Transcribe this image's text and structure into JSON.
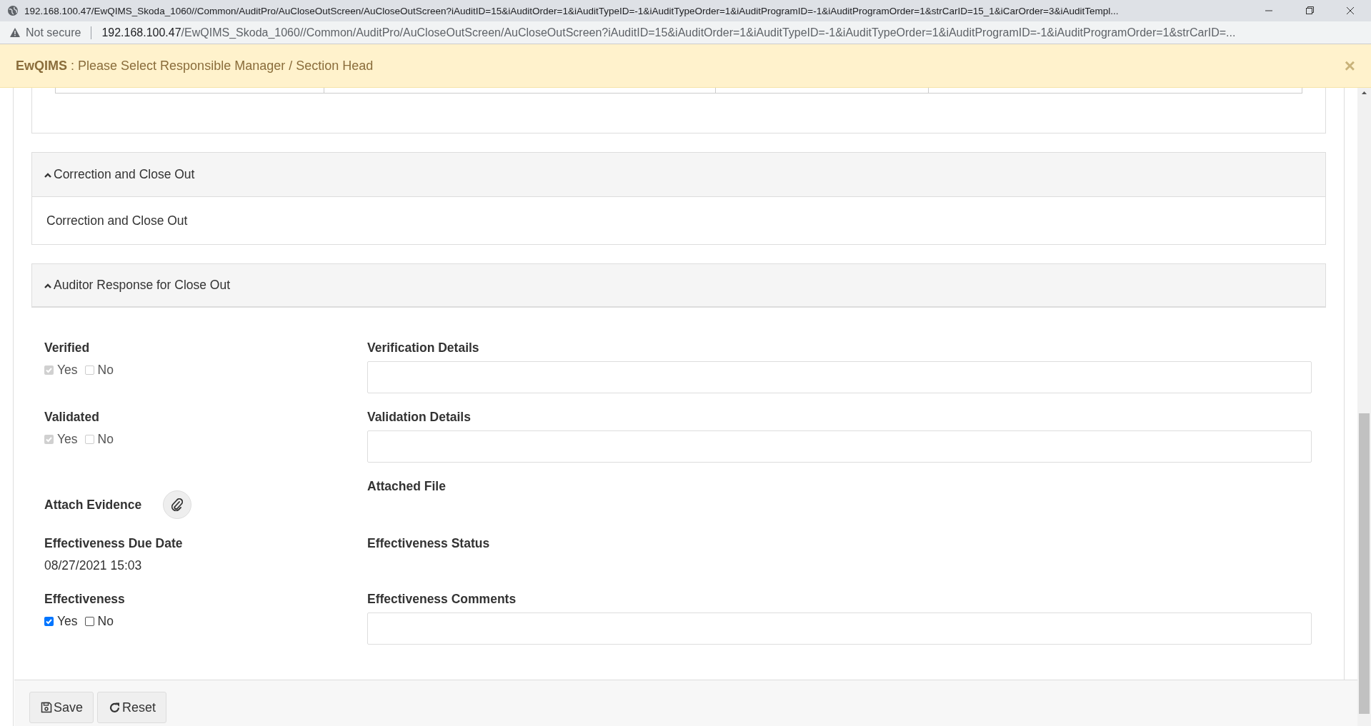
{
  "browser": {
    "title": "192.168.100.47/EwQIMS_Skoda_1060//Common/AuditPro/AuCloseOutScreen/AuCloseOutScreen?iAuditID=15&iAuditOrder=1&iAuditTypeID=-1&iAuditTypeOrder=1&iAuditProgramID=-1&iAuditProgramOrder=1&strCarID=15_1&iCarOrder=3&iAuditTempl...",
    "security": "Not secure",
    "url_host": "192.168.100.47",
    "url_path": "/EwQIMS_Skoda_1060//Common/AuditPro/AuCloseOutScreen/AuCloseOutScreen?iAuditID=15&iAuditOrder=1&iAuditTypeID=-1&iAuditTypeOrder=1&iAuditProgramID=-1&iAuditProgramOrder=1&strCarID=..."
  },
  "alert": {
    "brand": "EwQIMS",
    "message": " : Please Select Responsible Manager / Section Head",
    "close": "×"
  },
  "panels": [
    {
      "title": "Correction and Close Out",
      "expanded": true,
      "body": "Correction and Close Out"
    },
    {
      "title": "Auditor Response for Close Out",
      "expanded": true
    }
  ],
  "form_rows": [
    {
      "left": {
        "kind": "choice",
        "label": "Verified",
        "options": [
          {
            "label": "Yes",
            "checked": true,
            "disabled": true
          },
          {
            "label": "No",
            "checked": false,
            "disabled": true
          }
        ]
      },
      "right": {
        "kind": "field",
        "label": "Verification Details"
      }
    },
    {
      "left": {
        "kind": "choice",
        "label": "Validated",
        "options": [
          {
            "label": "Yes",
            "checked": true,
            "disabled": true
          },
          {
            "label": "No",
            "checked": false,
            "disabled": true
          }
        ]
      },
      "right": {
        "kind": "field",
        "label": "Validation Details"
      }
    },
    {
      "left": {
        "kind": "attach",
        "label": "Attach Evidence"
      },
      "right": {
        "kind": "label",
        "label": "Attached File"
      }
    },
    {
      "left": {
        "kind": "value",
        "label": "Effectiveness Due Date",
        "value": "08/27/2021 15:03"
      },
      "right": {
        "kind": "label",
        "label": "Effectiveness Status"
      }
    },
    {
      "left": {
        "kind": "choice",
        "label": "Effectiveness",
        "options": [
          {
            "label": "Yes",
            "checked": true,
            "disabled": false
          },
          {
            "label": "No",
            "checked": false,
            "disabled": false
          }
        ]
      },
      "right": {
        "kind": "field",
        "label": "Effectiveness Comments"
      }
    }
  ],
  "buttons": [
    {
      "kind": "save",
      "label": "Save"
    },
    {
      "kind": "reset",
      "label": "Reset"
    }
  ]
}
